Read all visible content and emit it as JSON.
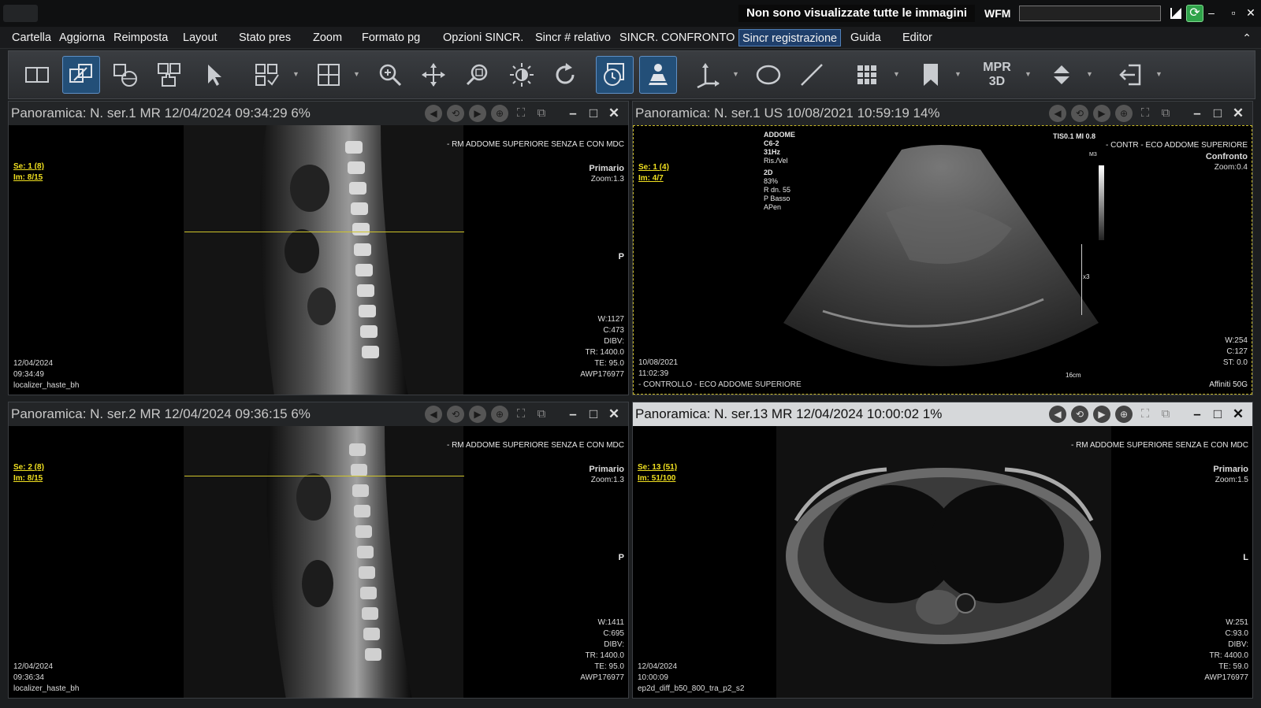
{
  "titlebar": {
    "warning": "Non sono visualizzate tutte le immagini",
    "wfm_label": "WFM",
    "wfm_value": ""
  },
  "menu": [
    "Cartella",
    "Aggiorna",
    "Reimposta",
    "Layout",
    "Stato pres",
    "Zoom",
    "Formato pg",
    "Opzioni SINCR.",
    "Sincr # relativo",
    "SINCR. CONFRONTO",
    "Sincr registrazione",
    "Guida",
    "Editor"
  ],
  "toolbar": {
    "mpr_line1": "MPR",
    "mpr_line2": "3D",
    "icons": [
      "layout-toggle-icon",
      "link-series-icon",
      "globe-sync-icon",
      "hand-pan-icon",
      "pointer-icon",
      "layout-grid-icon",
      "series-grid-icon",
      "magnify-icon",
      "move-icon",
      "zoom-rect-icon",
      "brightness-icon",
      "rotate-icon",
      "cine-icon",
      "patient-icon",
      "axis-icon",
      "ellipse-roi-icon",
      "line-measure-icon",
      "hanging-protocol-icon",
      "bookmark-icon",
      "mpr-3d-icon",
      "scroll-updown-icon",
      "exit-icon"
    ]
  },
  "panes": [
    {
      "header": "Panoramica: N. ser.1  MR 12/04/2024 09:34:29   6%",
      "study": "- RM  ADDOME SUPERIORE SENZA E CON MDC",
      "series_link": "Se: 1 (8)",
      "image_link": "Im: 8/15",
      "role": "Primario",
      "zoom": "Zoom:1.3",
      "orient": "P",
      "window": "W:1127",
      "center": "C:473",
      "params": [
        "DIBV:",
        "TR: 1400.0",
        "TE: 95.0",
        "AWP176977"
      ],
      "date": "12/04/2024",
      "time": "09:34:49",
      "sequence": "localizer_haste_bh"
    },
    {
      "header": "Panoramica: N. ser.1  US 10/08/2021 10:59:19  14%",
      "study": "- CONTR - ECO ADDOME SUPERIORE",
      "series_link": "Se: 1 (4)",
      "image_link": "Im: 4/7",
      "role": "Confronto",
      "zoom": "Zoom:0.4",
      "us_info": [
        "ADDOME",
        "C6-2",
        "31Hz",
        "Ris./Vel",
        "2D",
        "83%",
        "R dn. 55",
        "P Basso",
        "APen"
      ],
      "tis": "TIS0.1   MI 0.8",
      "m3": "M3",
      "x3": "x3",
      "depth": "16cm",
      "window": "W:254",
      "center": "C:127",
      "params": [
        "ST: 0.0"
      ],
      "date": "10/08/2021",
      "time": "11:02:39",
      "sequence": "- CONTROLLO - ECO ADDOME SUPERIORE",
      "device": "Affiniti 50G"
    },
    {
      "header": "Panoramica: N. ser.2  MR 12/04/2024 09:36:15   6%",
      "study": "- RM  ADDOME SUPERIORE SENZA E CON MDC",
      "series_link": "Se: 2 (8)",
      "image_link": "Im: 8/15",
      "role": "Primario",
      "zoom": "Zoom:1.3",
      "orient": "P",
      "window": "W:1411",
      "center": "C:695",
      "params": [
        "DIBV:",
        "TR: 1400.0",
        "TE: 95.0",
        "AWP176977"
      ],
      "date": "12/04/2024",
      "time": "09:36:34",
      "sequence": "localizer_haste_bh"
    },
    {
      "header": "Panoramica: N. ser.13  MR 12/04/2024 10:00:02  1%",
      "study": "- RM  ADDOME SUPERIORE SENZA E CON MDC",
      "series_link": "Se: 13 (51)",
      "image_link": "Im: 51/100",
      "role": "Primario",
      "zoom": "Zoom:1.5",
      "orient": "L",
      "window": "W:251",
      "center": "C:93.0",
      "params": [
        "DIBV:",
        "TR: 4400.0",
        "TE: 59.0",
        "AWP176977"
      ],
      "date": "12/04/2024",
      "time": "10:00:09",
      "sequence": "ep2d_diff_b50_800_tra_p2_s2"
    }
  ]
}
